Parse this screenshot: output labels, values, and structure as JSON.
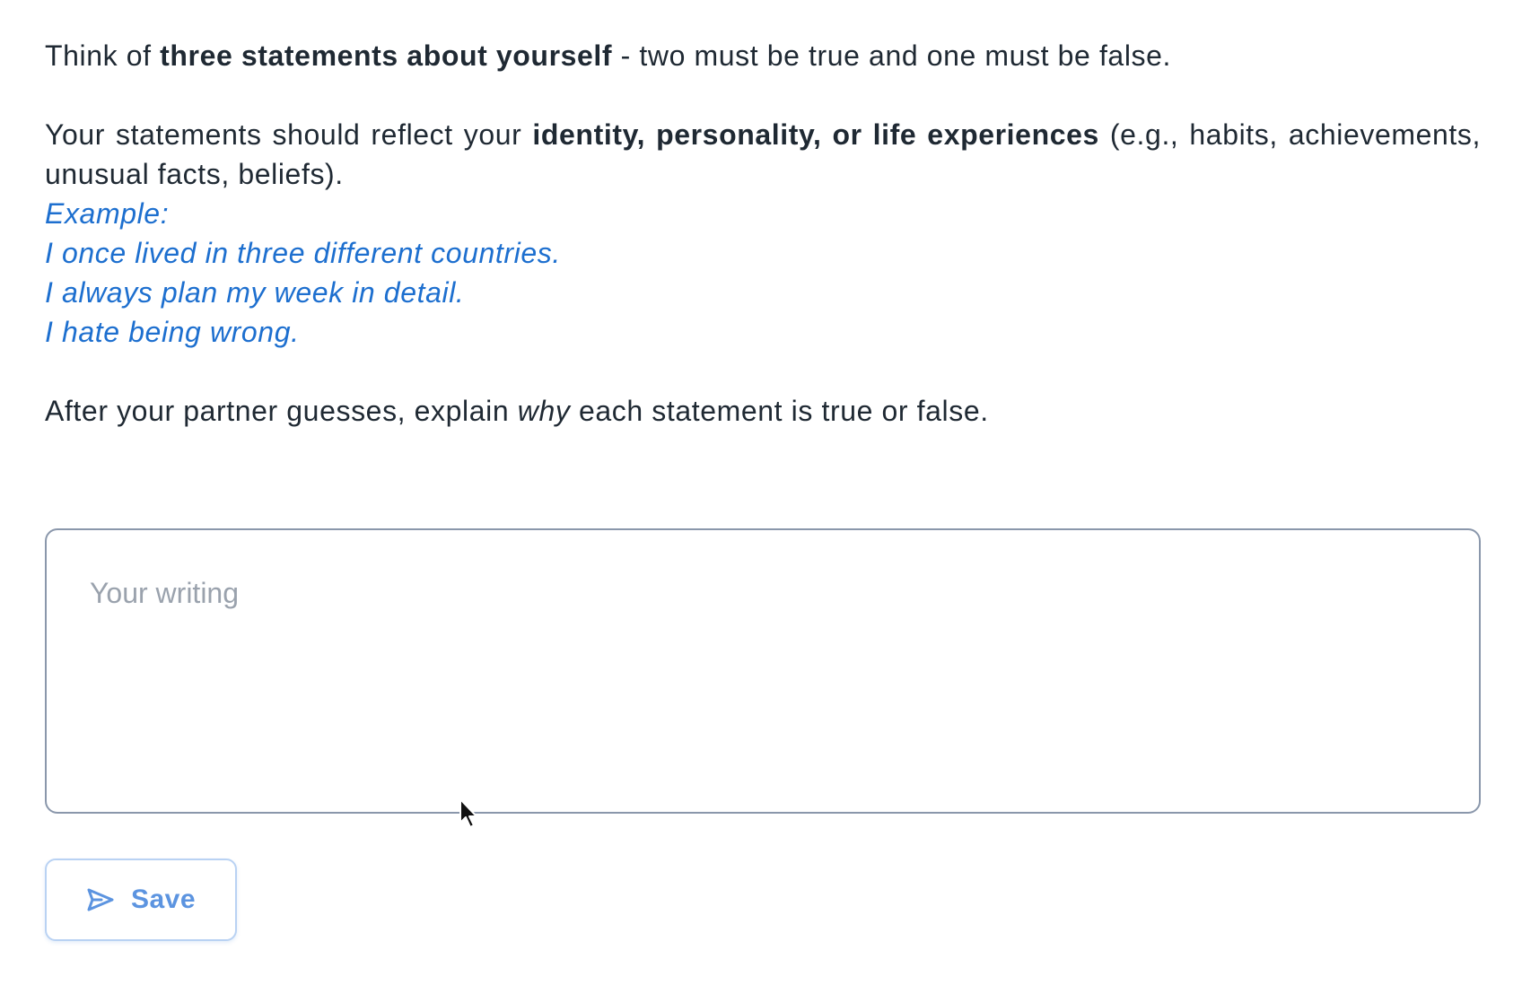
{
  "instructions": {
    "line1": {
      "prefix": "Think of ",
      "bold": "three statements about yourself",
      "suffix": " - two must be true and one must be false."
    },
    "line2": {
      "prefix": "Your statements should reflect your ",
      "bold": "identity, personality, or life experiences",
      "suffix": " (e.g., habits, achievements, unusual facts, beliefs)."
    },
    "example": {
      "label": "Example:",
      "items": [
        "I once lived in three different countries.",
        "I always plan my week in detail.",
        "I hate being wrong."
      ]
    },
    "line3": {
      "prefix": "After your partner guesses, explain ",
      "italic": "why",
      "suffix": " each statement is true or false."
    }
  },
  "writing": {
    "placeholder": "Your writing",
    "value": ""
  },
  "save_button": {
    "label": "Save",
    "icon": "send-icon"
  },
  "colors": {
    "text": "#1f2933",
    "example": "#1d6fcf",
    "accent": "#5c94e0",
    "border": "#8a97ab"
  }
}
